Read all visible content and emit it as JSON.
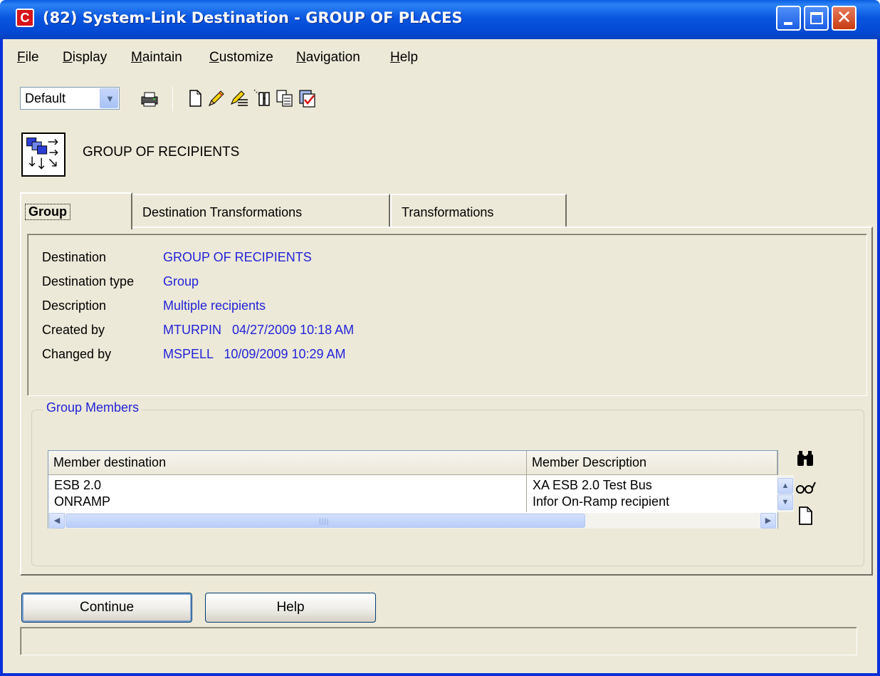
{
  "window": {
    "title": "(82) System-Link Destination - GROUP OF PLACES",
    "app_icon": "C"
  },
  "menu": [
    {
      "label": "File",
      "mnemonic": "F",
      "rest": "ile"
    },
    {
      "label": "Display",
      "mnemonic": "D",
      "rest": "isplay"
    },
    {
      "label": "Maintain",
      "mnemonic": "M",
      "rest": "aintain"
    },
    {
      "label": "Customize",
      "mnemonic": "C",
      "rest": "ustomize"
    },
    {
      "label": "Navigation",
      "mnemonic": "N",
      "rest": "avigation"
    },
    {
      "label": "Help",
      "mnemonic": "H",
      "rest": "elp"
    }
  ],
  "toolbar": {
    "view_select": "Default",
    "icons": [
      "print-icon",
      "new-document-icon",
      "edit-pencil-icon",
      "edit-list-icon",
      "filter-icon",
      "copy-icon",
      "checklist-icon"
    ]
  },
  "header": {
    "label": "GROUP OF RECIPIENTS",
    "icon": "group-destination-icon"
  },
  "tabs": [
    {
      "label": "Group",
      "active": true
    },
    {
      "label": "Destination Transformations",
      "active": false
    },
    {
      "label": "Transformations",
      "active": false
    }
  ],
  "details": {
    "destination": {
      "label": "Destination",
      "value": "GROUP OF RECIPIENTS"
    },
    "destination_type": {
      "label": "Destination type",
      "value": "Group"
    },
    "description": {
      "label": "Description",
      "value": "Multiple recipients"
    },
    "created_by": {
      "label": "Created by",
      "value": "MTURPIN   04/27/2009 10:18 AM"
    },
    "changed_by": {
      "label": "Changed by",
      "value": "MSPELL   10/09/2009 10:29 AM"
    }
  },
  "group_members": {
    "title": "Group Members",
    "columns": [
      "Member destination",
      "Member Description"
    ],
    "rows": [
      [
        "ESB 2.0",
        "XA ESB 2.0 Test Bus"
      ],
      [
        "ONRAMP",
        "Infor On-Ramp recipient"
      ]
    ],
    "side_icons": [
      "binoculars-icon",
      "glasses-icon",
      "new-document-icon"
    ]
  },
  "buttons": {
    "continue": "Continue",
    "help": "Help"
  },
  "status_bar": {
    "text": ""
  },
  "colors": {
    "window_frame": "#0831d9",
    "face": "#ece9d8",
    "value_text": "#2323d8",
    "close_button": "#c63b12"
  }
}
